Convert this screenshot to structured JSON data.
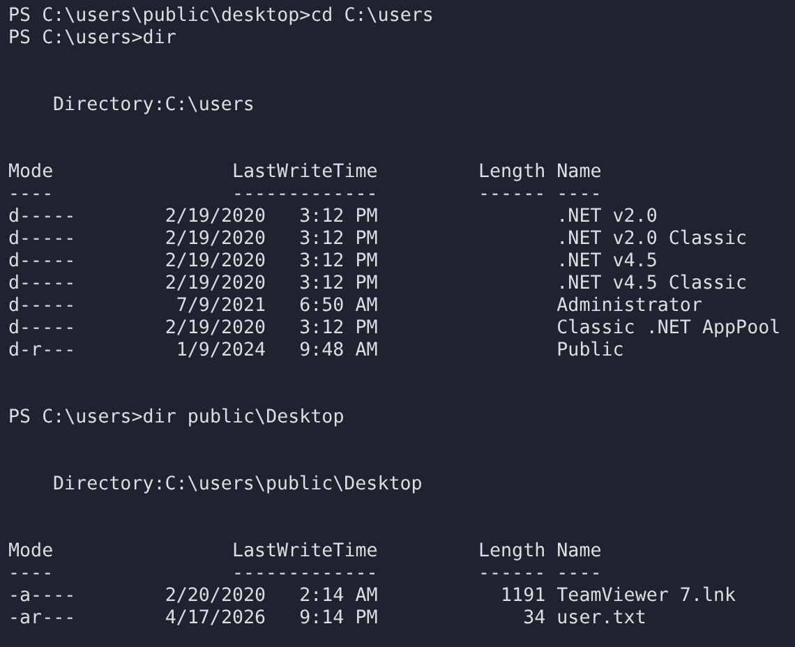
{
  "blocks": [
    {
      "kind": "prompt",
      "prompt": "PS C:\\users\\public\\desktop>",
      "command": "cd C:\\users"
    },
    {
      "kind": "prompt",
      "prompt": "PS C:\\users>",
      "command": "dir"
    },
    {
      "kind": "listing",
      "directory_label": "Directory:",
      "directory": "C:\\users",
      "columns": {
        "mode": "Mode",
        "time": "LastWriteTime",
        "length": "Length",
        "name": "Name"
      },
      "underlines": {
        "mode": "----",
        "time": "-------------",
        "length": "------",
        "name": "----"
      },
      "rows": [
        {
          "mode": "d-----",
          "date": "2/19/2020",
          "time": "3:12 PM",
          "name": ".NET v2.0"
        },
        {
          "mode": "d-----",
          "date": "2/19/2020",
          "time": "3:12 PM",
          "name": ".NET v2.0 Classic"
        },
        {
          "mode": "d-----",
          "date": "2/19/2020",
          "time": "3:12 PM",
          "name": ".NET v4.5"
        },
        {
          "mode": "d-----",
          "date": "2/19/2020",
          "time": "3:12 PM",
          "name": ".NET v4.5 Classic"
        },
        {
          "mode": "d-----",
          "date": "7/9/2021",
          "time": "6:50 AM",
          "name": "Administrator"
        },
        {
          "mode": "d-----",
          "date": "2/19/2020",
          "time": "3:12 PM",
          "name": "Classic .NET AppPool"
        },
        {
          "mode": "d-r---",
          "date": "1/9/2024",
          "time": "9:48 AM",
          "name": "Public"
        }
      ]
    },
    {
      "kind": "prompt",
      "prompt": "PS C:\\users>",
      "command": "dir public\\Desktop"
    },
    {
      "kind": "listing",
      "directory_label": "Directory:",
      "directory": "C:\\users\\public\\Desktop",
      "columns": {
        "mode": "Mode",
        "time": "LastWriteTime",
        "length": "Length",
        "name": "Name"
      },
      "underlines": {
        "mode": "----",
        "time": "-------------",
        "length": "------",
        "name": "----"
      },
      "rows": [
        {
          "mode": "-a----",
          "date": "2/20/2020",
          "time": "2:14 AM",
          "length": "1191",
          "name": "TeamViewer 7.lnk"
        },
        {
          "mode": "-ar---",
          "date": "4/17/2026",
          "time": "9:14 PM",
          "length": "34",
          "name": "user.txt"
        }
      ]
    }
  ]
}
